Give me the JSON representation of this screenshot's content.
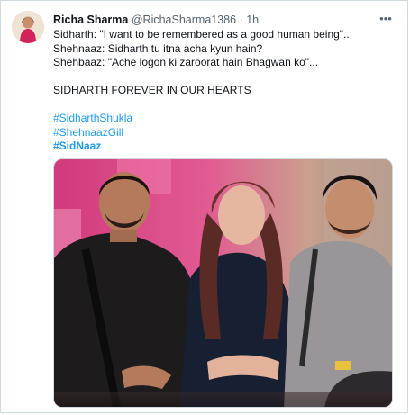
{
  "tweet": {
    "display_name": "Richa Sharma",
    "handle": "@RichaSharma1386",
    "separator": "·",
    "time": "1h",
    "more_icon": "ellipsis-icon",
    "lines": [
      "Sidharth: \"I want to be remembered as a good human being\"..",
      "Shehnaaz: Sidharth tu itna acha kyun hain?",
      "Shehbaaz: \"Ache logon ki zaroorat hain Bhagwan ko\"...",
      "SIDHARTH FOREVER IN OUR HEARTS"
    ],
    "hashtags": [
      "#SidharthShukla",
      "#ShehnaazGill",
      "#SidNaaz"
    ]
  },
  "colors": {
    "link": "#1d9bf0",
    "muted": "#536471",
    "border": "#cfd9de"
  }
}
